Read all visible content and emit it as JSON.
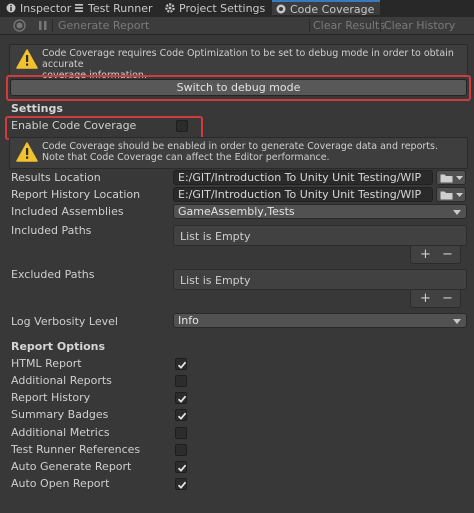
{
  "tabs": [
    {
      "label": "Inspector",
      "icon": "info-icon"
    },
    {
      "label": "Test Runner",
      "icon": "list-icon"
    },
    {
      "label": "Project Settings",
      "icon": "gear-icon"
    },
    {
      "label": "Code Coverage",
      "icon": "code-coverage-icon",
      "active": true
    }
  ],
  "toolbar": {
    "generate_report": "Generate Report",
    "clear_results": "Clear Results",
    "clear_history": "Clear History"
  },
  "warnings": {
    "debug_mode": "Code Coverage requires Code Optimization to be set to debug mode in order to obtain accurate coverage information.",
    "debug_mode_line1": "Code Coverage requires Code Optimization to be set to debug mode in order to obtain accurate",
    "debug_mode_line2": "coverage information.",
    "enable_line1": "Code Coverage should be enabled in order to generate Coverage data and reports.",
    "enable_line2": "Note that Code Coverage can affect the Editor performance."
  },
  "switch_button": "Switch to debug mode",
  "settings": {
    "header": "Settings",
    "enable_label": "Enable Code Coverage",
    "enable_checked": false,
    "results_location_label": "Results Location",
    "results_location_value": "E:/GIT/Introduction To Unity Unit Testing/WIP",
    "report_history_label": "Report History Location",
    "report_history_value": "E:/GIT/Introduction To Unity Unit Testing/WIP",
    "included_assemblies_label": "Included Assemblies",
    "included_assemblies_value": "GameAssembly,Tests",
    "included_paths_label": "Included Paths",
    "included_paths_empty": "List is Empty",
    "excluded_paths_label": "Excluded Paths",
    "excluded_paths_empty": "List is Empty",
    "log_verbosity_label": "Log Verbosity Level",
    "log_verbosity_value": "Info"
  },
  "list_buttons": {
    "add": "+",
    "remove": "−"
  },
  "report_options": {
    "header": "Report Options",
    "items": [
      {
        "label": "HTML Report",
        "checked": true
      },
      {
        "label": "Additional Reports",
        "checked": false
      },
      {
        "label": "Report History",
        "checked": true
      },
      {
        "label": "Summary Badges",
        "checked": true
      },
      {
        "label": "Additional Metrics",
        "checked": false
      },
      {
        "label": "Test Runner References",
        "checked": false
      },
      {
        "label": "Auto Generate Report",
        "checked": true
      },
      {
        "label": "Auto Open Report",
        "checked": true
      }
    ]
  },
  "colors": {
    "background": "#383838",
    "highlight_red": "#d23b3b",
    "warning_yellow": "#f2c12e",
    "active_tab_accent": "#3a79bb"
  }
}
